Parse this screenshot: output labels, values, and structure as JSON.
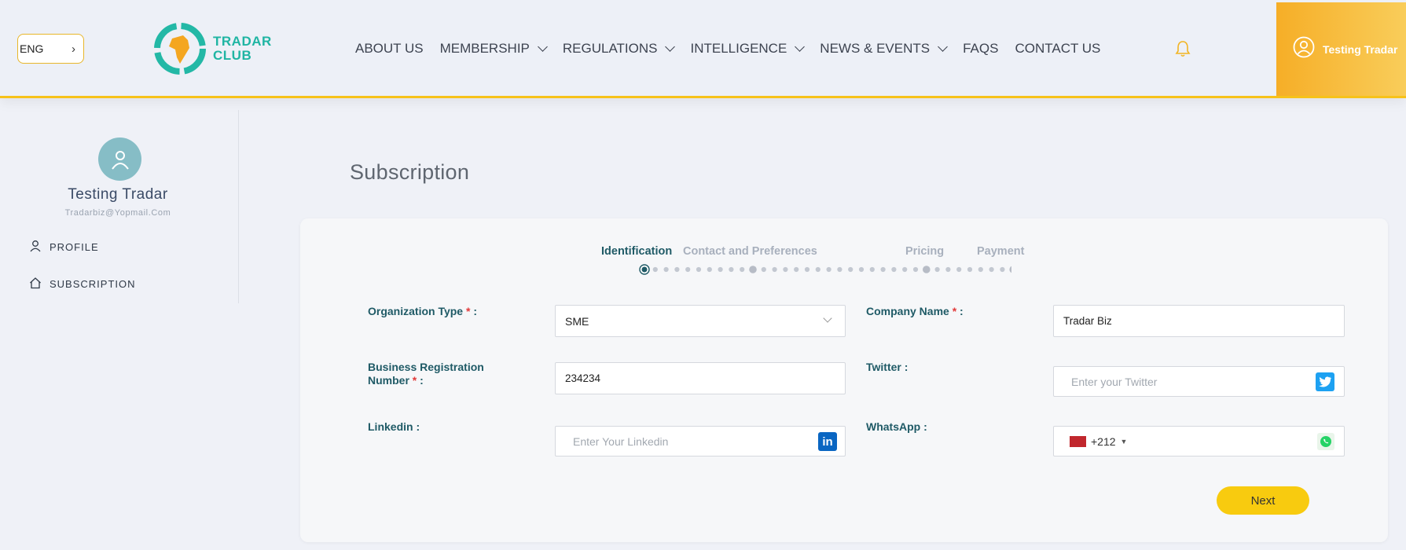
{
  "header": {
    "language": "ENG",
    "logo_line1": "TRADAR",
    "logo_line2": "CLUB",
    "nav": [
      {
        "label": "ABOUT US",
        "dropdown": false
      },
      {
        "label": "MEMBERSHIP",
        "dropdown": true
      },
      {
        "label": "REGULATIONS",
        "dropdown": true
      },
      {
        "label": "INTELLIGENCE",
        "dropdown": true
      },
      {
        "label": "NEWS & EVENTS",
        "dropdown": true
      },
      {
        "label": "FAQS",
        "dropdown": false
      },
      {
        "label": "CONTACT US",
        "dropdown": false
      }
    ],
    "user_name": "Testing Tradar"
  },
  "sidebar": {
    "name": "Testing Tradar",
    "email": "Tradarbiz@Yopmail.Com",
    "items": [
      {
        "label": "PROFILE",
        "icon": "user-icon"
      },
      {
        "label": "SUBSCRIPTION",
        "icon": "home-icon"
      }
    ]
  },
  "main": {
    "title": "Subscription",
    "steps": [
      {
        "label": "Identification",
        "active": true
      },
      {
        "label": "Contact and Preferences",
        "active": false
      },
      {
        "label": "Pricing",
        "active": false
      },
      {
        "label": "Payment",
        "active": false
      }
    ],
    "form": {
      "organization_type": {
        "label": "Organization Type",
        "value": "SME"
      },
      "company_name": {
        "label": "Company Name",
        "value": "Tradar Biz"
      },
      "business_reg_line1": "Business Registration",
      "business_reg_line2": "Number",
      "business_reg_value": "234234",
      "twitter": {
        "label": "Twitter",
        "placeholder": "Enter your Twitter"
      },
      "linkedin": {
        "label": "Linkedin",
        "placeholder": "Enter Your Linkedin"
      },
      "whatsapp": {
        "label": "WhatsApp",
        "dial_code": "+212"
      },
      "required_mark": "*",
      "colon": ":"
    },
    "next_label": "Next"
  },
  "colors": {
    "accent": "#f7c21a",
    "teal": "#1f5a66",
    "brand": "#1fb5a3"
  }
}
